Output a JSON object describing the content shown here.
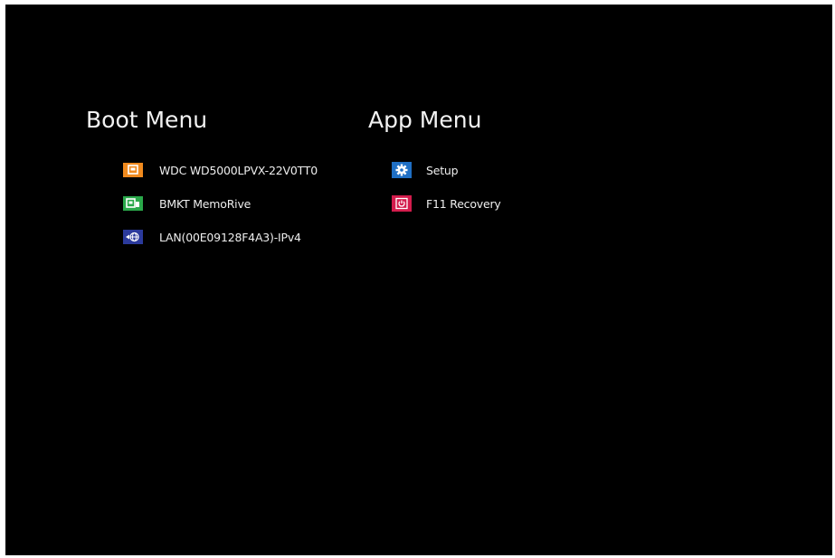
{
  "boot_menu": {
    "title": "Boot Menu",
    "items": [
      {
        "label": "WDC WD5000LPVX-22V0TT0",
        "icon": "hard-drive-icon",
        "color": "#f08a1e"
      },
      {
        "label": "BMKT MemoRive",
        "icon": "usb-drive-icon",
        "color": "#2aa84a"
      },
      {
        "label": "LAN(00E09128F4A3)-IPv4",
        "icon": "network-globe-icon",
        "color": "#2b3a9c"
      }
    ]
  },
  "app_menu": {
    "title": "App Menu",
    "items": [
      {
        "label": "Setup",
        "icon": "gear-icon",
        "color": "#1f6fc4"
      },
      {
        "label": "F11 Recovery",
        "icon": "power-icon",
        "color": "#d31c4c"
      }
    ]
  }
}
